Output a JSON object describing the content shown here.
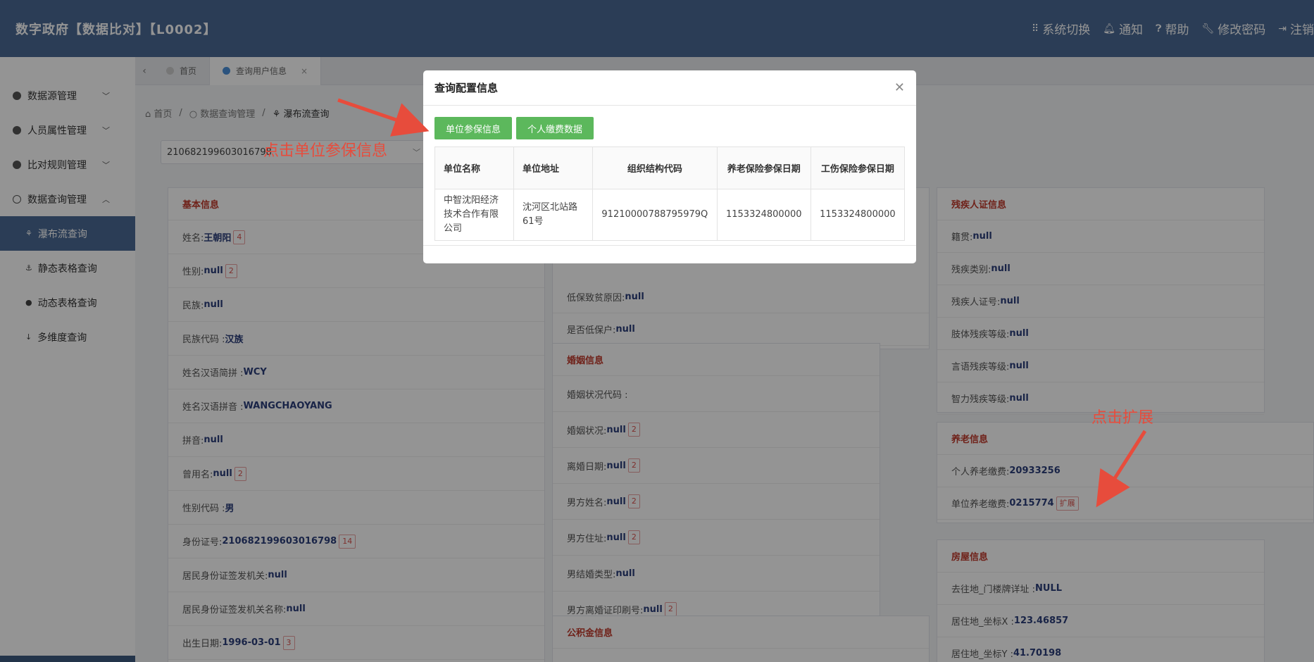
{
  "header": {
    "title": "数字政府【数据比对】【L0002】",
    "nav": [
      {
        "label": "系统切换",
        "icon": "grid-icon"
      },
      {
        "label": "通知",
        "icon": "bell-icon"
      },
      {
        "label": "帮助",
        "icon": "help-icon"
      },
      {
        "label": "修改密码",
        "icon": "wrench-icon"
      },
      {
        "label": "注销",
        "icon": "logout-icon"
      }
    ]
  },
  "sidebar": {
    "items": [
      {
        "label": "数据源管理"
      },
      {
        "label": "人员属性管理"
      },
      {
        "label": "比对规则管理"
      },
      {
        "label": "数据查询管理"
      }
    ],
    "subitems": [
      {
        "label": "瀑布流查询"
      },
      {
        "label": "静态表格查询"
      },
      {
        "label": "动态表格查询"
      },
      {
        "label": "多维度查询"
      }
    ]
  },
  "tabs": [
    {
      "label": "首页"
    },
    {
      "label": "查询用户信息"
    }
  ],
  "breadcrumb": {
    "home": "首页",
    "parent": "数据查询管理",
    "current": "瀑布流查询"
  },
  "select_value": "210682199603016798",
  "basic": {
    "title": "基本信息",
    "rows": [
      {
        "label": "姓名:",
        "value": "王朝阳",
        "badge": "4"
      },
      {
        "label": "性别:",
        "value": "null",
        "badge": "2"
      },
      {
        "label": "民族:",
        "value": "null",
        "badge": ""
      },
      {
        "label": "民族代码 :",
        "value": "汉族",
        "badge": ""
      },
      {
        "label": "姓名汉语简拼 :",
        "value": "WCY",
        "badge": ""
      },
      {
        "label": "姓名汉语拼音 :",
        "value": "WANGCHAOYANG",
        "badge": ""
      },
      {
        "label": "拼音:",
        "value": "null",
        "badge": ""
      },
      {
        "label": "曾用名:",
        "value": "null",
        "badge": "2"
      },
      {
        "label": "性别代码 :",
        "value": "男",
        "badge": ""
      },
      {
        "label": "身份证号:",
        "value": "210682199603016798",
        "badge": "14"
      },
      {
        "label": "居民身份证签发机关:",
        "value": "null",
        "badge": ""
      },
      {
        "label": "居民身份证签发机关名称:",
        "value": "null",
        "badge": ""
      },
      {
        "label": "出生日期:",
        "value": "1996-03-01",
        "badge": "3"
      }
    ]
  },
  "dibao": {
    "rows": [
      {
        "label": "低保致贫原因:",
        "value": "null"
      },
      {
        "label": "是否低保户:",
        "value": "null"
      }
    ]
  },
  "marriage": {
    "title": "婚姻信息",
    "rows": [
      {
        "label": "婚姻状况代码 :",
        "value": "",
        "badge": ""
      },
      {
        "label": "婚姻状况:",
        "value": "null",
        "badge": "2"
      },
      {
        "label": "离婚日期:",
        "value": "null",
        "badge": "2"
      },
      {
        "label": "男方姓名:",
        "value": "null",
        "badge": "2"
      },
      {
        "label": "男方住址:",
        "value": "null",
        "badge": "2"
      },
      {
        "label": "男结婚类型:",
        "value": "null",
        "badge": ""
      },
      {
        "label": "男方离婚证印刷号:",
        "value": "null",
        "badge": "2"
      }
    ]
  },
  "fund": {
    "title": "公积金信息"
  },
  "disability": {
    "title": "残疾人证信息",
    "rows": [
      {
        "label": "籍贯:",
        "value": "null"
      },
      {
        "label": "残疾类别:",
        "value": "null"
      },
      {
        "label": "残疾人证号:",
        "value": "null"
      },
      {
        "label": "肢体残疾等级:",
        "value": "null"
      },
      {
        "label": "言语残疾等级:",
        "value": "null"
      },
      {
        "label": "智力残疾等级:",
        "value": "null"
      }
    ]
  },
  "pension": {
    "title": "养老信息",
    "rows": [
      {
        "label": "个人养老缴费:",
        "value": "20933256",
        "badge": ""
      },
      {
        "label": "单位养老缴费:",
        "value": "0215774",
        "badge": "扩展"
      }
    ]
  },
  "housing": {
    "title": "房屋信息",
    "rows": [
      {
        "label": "去往地_门楼牌详址 :",
        "value": "NULL"
      },
      {
        "label": "居住地_坐标X :",
        "value": "123.46857"
      },
      {
        "label": "居住地_坐标Y :",
        "value": "41.70198"
      }
    ]
  },
  "modal": {
    "title": "查询配置信息",
    "buttons": [
      "单位参保信息",
      "个人缴费数据"
    ],
    "columns": [
      "单位名称",
      "单位地址",
      "组织结构代码",
      "养老保险参保日期",
      "工伤保险参保日期"
    ],
    "rows": [
      [
        "中智沈阳经济技术合作有限公司",
        "沈河区北站路61号",
        "91210000788795979Q",
        "1153324800000",
        "1153324800000"
      ]
    ]
  },
  "annotations": {
    "left": "点击单位参保信息",
    "right": "点击扩展",
    "color": "#e74c3c"
  },
  "colors": {
    "header": "#4a6a94",
    "accent_green": "#5cb85c",
    "section_title": "#c0392b"
  }
}
